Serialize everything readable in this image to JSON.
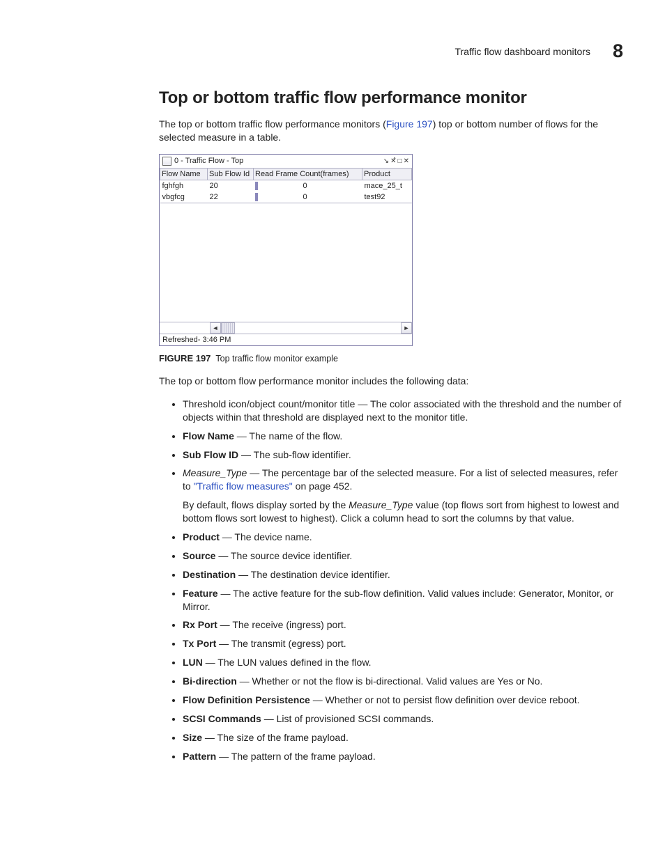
{
  "header": {
    "section_title": "Traffic flow dashboard monitors",
    "chapter_number": "8"
  },
  "heading": "Top or bottom traffic flow performance monitor",
  "intro_pre": "The top or bottom traffic flow performance monitors (",
  "intro_link": "Figure 197",
  "intro_post": ") top or bottom number of flows for the selected measure in a table.",
  "figure": {
    "title": "0 - Traffic Flow - Top",
    "columns": [
      "Flow Name",
      "Sub Flow Id",
      "Read Frame Count(frames)",
      "Product"
    ],
    "rows": [
      {
        "flow_name": "fghfgh",
        "sub_flow_id": "20",
        "value": "0",
        "product": "mace_25_t"
      },
      {
        "flow_name": "vbgfcg",
        "sub_flow_id": "22",
        "value": "0",
        "product": "test92"
      }
    ],
    "refreshed": "Refreshed- 3:46 PM",
    "caption_label": "FIGURE 197",
    "caption_text": "Top traffic flow monitor example"
  },
  "after_figure": "The top or bottom flow performance monitor includes the following data:",
  "bullets": {
    "b0": "Threshold icon/object count/monitor title — The color associated with the threshold and the number of objects within that threshold are displayed next to the monitor title.",
    "b1_term": "Flow Name",
    "b1_desc": " — The name of the flow.",
    "b2_term": "Sub Flow ID",
    "b2_desc": " — The sub-flow identifier.",
    "b3_term": "Measure_Type",
    "b3_desc_pre": " — The percentage bar of the selected measure. For a list of selected measures, refer to ",
    "b3_link": "\"Traffic flow measures\"",
    "b3_desc_post": " on page 452.",
    "b3_sub_pre": "By default, flows display sorted by the ",
    "b3_sub_em": "Measure_Type",
    "b3_sub_post": " value (top flows sort from highest to lowest and bottom flows sort lowest to highest). Click a column head to sort the columns by that value.",
    "b4_term": "Product",
    "b4_desc": " — The device name.",
    "b5_term": "Source",
    "b5_desc": " — The source device identifier.",
    "b6_term": "Destination",
    "b6_desc": " — The destination device identifier.",
    "b7_term": "Feature",
    "b7_desc": " — The active feature for the sub-flow definition. Valid values include: Generator, Monitor, or Mirror.",
    "b8_term": "Rx Port",
    "b8_desc": " — The receive (ingress) port.",
    "b9_term": "Tx Port",
    "b9_desc": " — The transmit (egress) port.",
    "b10_term": "LUN",
    "b10_desc": " — The LUN values defined in the flow.",
    "b11_term": "Bi-direction",
    "b11_desc": " — Whether or not the flow is bi-directional. Valid values are Yes or No.",
    "b12_term": "Flow Definition Persistence",
    "b12_desc": " — Whether or not to persist flow definition over device reboot.",
    "b13_term": "SCSI Commands",
    "b13_desc": " — List of provisioned SCSI commands.",
    "b14_term": "Size",
    "b14_desc": " — The size of the frame payload.",
    "b15_term": "Pattern",
    "b15_desc": " — The pattern of the frame payload."
  }
}
